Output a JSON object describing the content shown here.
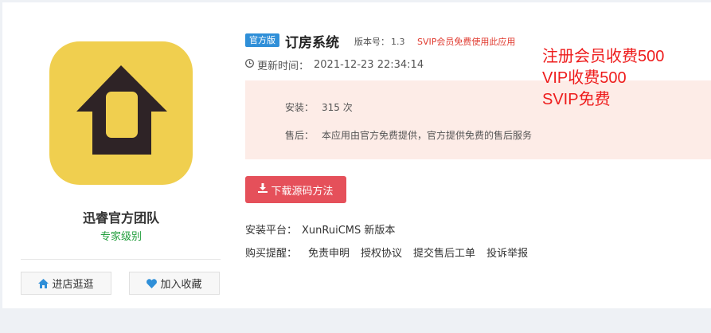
{
  "author": {
    "name": "迅睿官方团队",
    "level": "专家级别"
  },
  "side_buttons": {
    "shop": "进店逛逛",
    "favorite": "加入收藏"
  },
  "app": {
    "badge": "官方版",
    "title": "订房系统",
    "version_label": "版本号：",
    "version": "1.3",
    "svip_note": "SVIP会员免费使用此应用",
    "update_label": "更新时间：",
    "update_time": "2021-12-23 22:34:14"
  },
  "info": {
    "install_label": "安装：",
    "install_value": "315 次",
    "after_label": "售后：",
    "after_value": "本应用由官方免费提供，官方提供免费的售后服务"
  },
  "download_button": "下载源码方法",
  "platform": {
    "label": "安装平台：",
    "value": "XunRuiCMS 新版本"
  },
  "remind": {
    "label": "购买提醒：",
    "links": [
      "免责申明",
      "授权协议",
      "提交售后工单",
      "投诉举报"
    ]
  },
  "red_notes": [
    "注册会员收费500",
    "VIP收费500",
    "SVIP免费"
  ],
  "colors": {
    "logo_bg": "#f0cf4f",
    "accent": "#2f8fd8",
    "danger": "#e5505a",
    "note_red": "#ee1c1c"
  },
  "icons": {
    "shop": "home-icon",
    "favorite": "heart-icon",
    "update": "clock-icon",
    "download": "download-icon"
  }
}
